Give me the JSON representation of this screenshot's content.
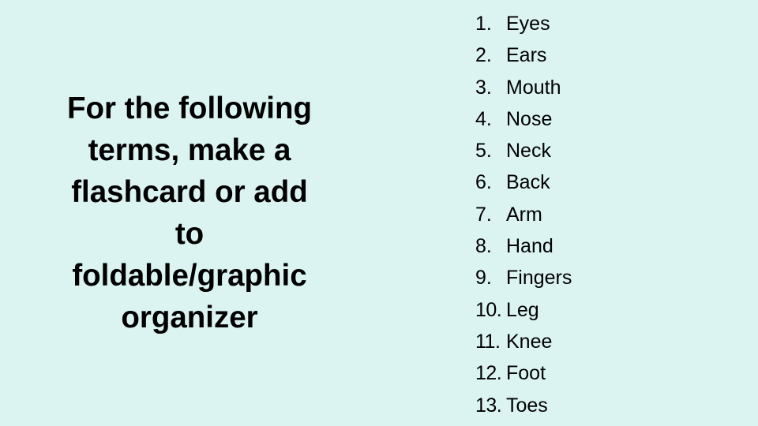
{
  "slide": {
    "background_color": "#dbf4f2",
    "heading_lines": [
      "For the following",
      "terms, make a",
      "flashcard or add",
      "to",
      "foldable/graphic",
      "organizer"
    ],
    "terms": [
      {
        "number": "1.",
        "label": "Eyes"
      },
      {
        "number": "2.",
        "label": "Ears"
      },
      {
        "number": "3.",
        "label": "Mouth"
      },
      {
        "number": "4.",
        "label": "Nose"
      },
      {
        "number": "5.",
        "label": "Neck"
      },
      {
        "number": "6.",
        "label": "Back"
      },
      {
        "number": "7.",
        "label": "Arm"
      },
      {
        "number": "8.",
        "label": "Hand"
      },
      {
        "number": "9.",
        "label": "Fingers"
      },
      {
        "number": "10.",
        "label": "Leg"
      },
      {
        "number": "11.",
        "label": "Knee"
      },
      {
        "number": "12.",
        "label": "Foot"
      },
      {
        "number": "13.",
        "label": "Toes"
      }
    ]
  }
}
